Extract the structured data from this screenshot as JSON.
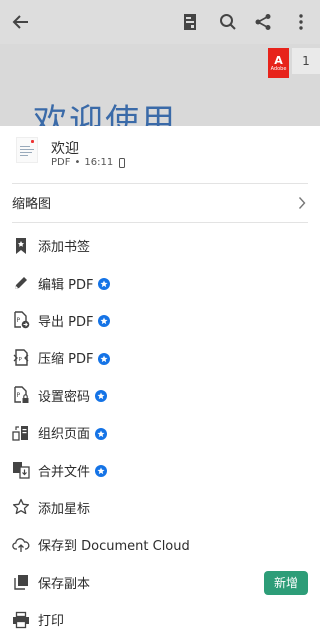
{
  "viewer": {
    "doc_heading": "欢迎使用",
    "page_number": "1",
    "adobe_badge": "Adobe",
    "icons": [
      "back-arrow-icon",
      "reading-mode-icon",
      "search-icon",
      "share-icon",
      "more-vertical-icon"
    ]
  },
  "file": {
    "name": "欢迎",
    "type": "PDF",
    "separator": "•",
    "time": "16:11",
    "storage_icon": "phone-icon"
  },
  "thumbnails": {
    "label": "缩略图"
  },
  "menu": {
    "items": [
      {
        "label": "添加书签",
        "icon": "bookmark-icon",
        "premium": false
      },
      {
        "label": "编辑 PDF",
        "icon": "pencil-icon",
        "premium": true
      },
      {
        "label": "导出 PDF",
        "icon": "export-pdf-icon",
        "premium": true
      },
      {
        "label": "压缩 PDF",
        "icon": "compress-pdf-icon",
        "premium": true
      },
      {
        "label": "设置密码",
        "icon": "lock-file-icon",
        "premium": true
      },
      {
        "label": "组织页面",
        "icon": "organize-pages-icon",
        "premium": true
      },
      {
        "label": "合并文件",
        "icon": "combine-files-icon",
        "premium": true
      },
      {
        "label": "添加星标",
        "icon": "star-icon",
        "premium": false
      },
      {
        "label": "保存到 Document Cloud",
        "icon": "cloud-upload-icon",
        "premium": false
      },
      {
        "label": "保存副本",
        "icon": "copy-icon",
        "premium": false,
        "badge": "新增"
      },
      {
        "label": "打印",
        "icon": "print-icon",
        "premium": false
      }
    ]
  },
  "colors": {
    "premium_badge": "#1473e6",
    "new_badge": "#2d9d78",
    "heading_blue": "#3a6aa8",
    "adobe_red": "#e7231b"
  }
}
